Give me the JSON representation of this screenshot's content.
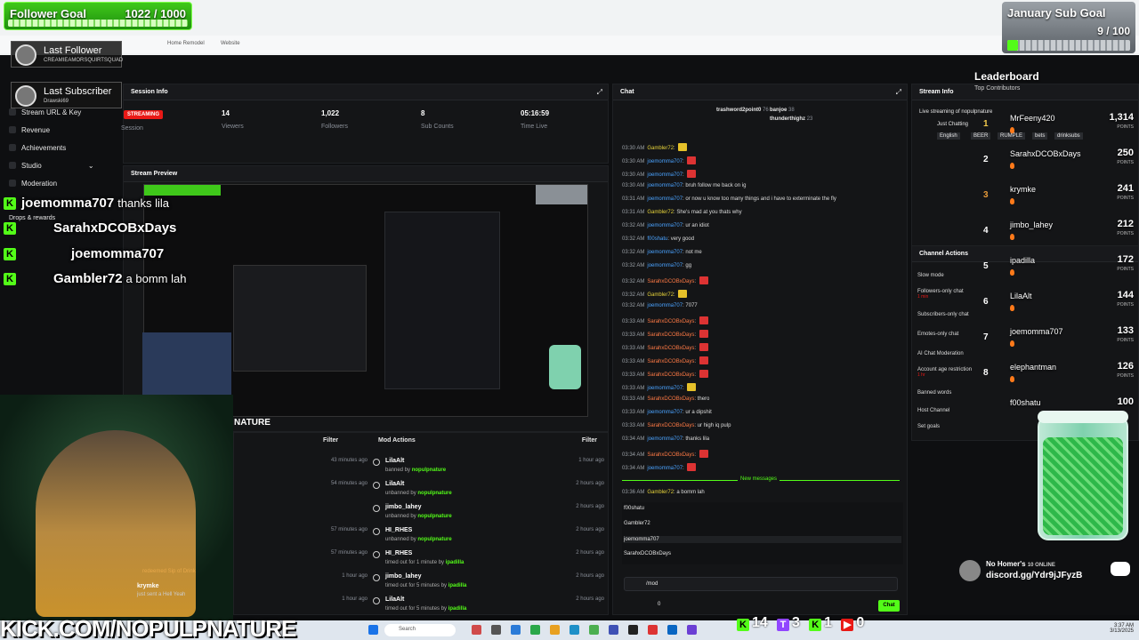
{
  "browser": {
    "bookmarks": [
      "Home Remodel",
      "Website"
    ]
  },
  "overlays": {
    "follower_goal": {
      "title": "Follower Goal",
      "value": "1022 / 1000",
      "progress": 1.0
    },
    "sub_goal": {
      "title": "January Sub Goal",
      "value": "9 / 100",
      "progress": 0.09
    },
    "last_follower": {
      "title": "Last Follower",
      "name": "CREAMIEAMORSQUIRTSQUAD"
    },
    "last_subscriber": {
      "title": "Last Subscriber",
      "name": "Drawski69"
    },
    "kick_url": "KICK.COM/NOPULPNATURE"
  },
  "sidebar": {
    "items": [
      {
        "label": "Stream URL & Key",
        "icon": "key-icon"
      },
      {
        "label": "Revenue",
        "icon": "revenue-icon"
      },
      {
        "label": "Achievements",
        "icon": "trophy-icon"
      },
      {
        "label": "Studio",
        "icon": "studio-icon"
      },
      {
        "label": "Moderation",
        "icon": "shield-icon"
      },
      {
        "label": "Drops & rewards",
        "icon": "gift-icon"
      }
    ]
  },
  "session": {
    "title": "Session Info",
    "status": "STREAMING",
    "session_label": "Session",
    "stats": [
      {
        "value": "14",
        "label": "Viewers"
      },
      {
        "value": "1,022",
        "label": "Followers"
      },
      {
        "value": "8",
        "label": "Sub Counts"
      },
      {
        "value": "05:16:59",
        "label": "Time Live"
      }
    ]
  },
  "preview": {
    "title": "Stream Preview"
  },
  "mod_actions": {
    "title": "Mod Actions",
    "filter": "Filter",
    "rows": [
      {
        "left_time": "43 minutes ago",
        "user": "LilaAlt",
        "action": "banned by",
        "by": "nopulpnature",
        "time": "1 hour ago"
      },
      {
        "left_time": "54 minutes ago",
        "user": "LilaAlt",
        "action": "unbanned by",
        "by": "nopulpnature",
        "time": "2 hours ago"
      },
      {
        "left_time": "",
        "user": "jimbo_lahey",
        "action": "unbanned by",
        "by": "nopulpnature",
        "time": "2 hours ago"
      },
      {
        "left_time": "57 minutes ago",
        "user": "HI_RHES",
        "action": "unbanned by",
        "by": "nopulpnature",
        "time": "2 hours ago"
      },
      {
        "left_time": "57 minutes ago",
        "user": "HI_RHES",
        "action": "timed out for 1 minute by",
        "by": "ipadilla",
        "time": "2 hours ago"
      },
      {
        "left_time": "1 hour ago",
        "user": "jimbo_lahey",
        "action": "timed out for 5 minutes by",
        "by": "ipadilla",
        "time": "2 hours ago"
      },
      {
        "left_time": "1 hour ago",
        "user": "LilaAlt",
        "action": "timed out for 5 minutes by",
        "by": "ipadilla",
        "time": "2 hours ago"
      }
    ],
    "left_filter": "Filter",
    "events": [
      {
        "text": "redeemed Sip of Drink"
      },
      {
        "user": "krymke",
        "text": "just sent a Hell Yeah"
      }
    ]
  },
  "chat": {
    "title": "Chat",
    "pinned": [
      {
        "name": "trashword2point0",
        "count": "76"
      },
      {
        "name": "banjoe",
        "count": "38"
      },
      {
        "name": "thunderthighz",
        "count": "23"
      }
    ],
    "messages": [
      {
        "time": "03:30 AM",
        "user": "Gambler72",
        "text": ""
      },
      {
        "time": "03:30 AM",
        "user": "joemomma707",
        "text": ""
      },
      {
        "time": "03:30 AM",
        "user": "joemomma707",
        "text": ""
      },
      {
        "time": "03:30 AM",
        "user": "joemomma707",
        "text": "bruh follow me back on ig"
      },
      {
        "time": "03:31 AM",
        "user": "joemomma707",
        "text": "or now u know too many things and i have to exterminate the fly"
      },
      {
        "time": "03:31 AM",
        "user": "Gambler72",
        "text": "She's mad at you thats why"
      },
      {
        "time": "03:32 AM",
        "user": "joemomma707",
        "text": "ur an idiot"
      },
      {
        "time": "03:32 AM",
        "user": "f00shatu",
        "text": "very good"
      },
      {
        "time": "03:32 AM",
        "user": "joemomma707",
        "text": "not me"
      },
      {
        "time": "03:32 AM",
        "user": "joemomma707",
        "text": "gg"
      },
      {
        "time": "03:32 AM",
        "user": "SarahxDCOBxDays",
        "text": ""
      },
      {
        "time": "03:32 AM",
        "user": "Gambler72",
        "text": ""
      },
      {
        "time": "03:32 AM",
        "user": "joemomma707",
        "text": "7077"
      },
      {
        "time": "03:33 AM",
        "user": "SarahxDCOBxDays",
        "text": ""
      },
      {
        "time": "03:33 AM",
        "user": "SarahxDCOBxDays",
        "text": ""
      },
      {
        "time": "03:33 AM",
        "user": "SarahxDCOBxDays",
        "text": ""
      },
      {
        "time": "03:33 AM",
        "user": "SarahxDCOBxDays",
        "text": ""
      },
      {
        "time": "03:33 AM",
        "user": "SarahxDCOBxDays",
        "text": ""
      },
      {
        "time": "03:33 AM",
        "user": "joemomma707",
        "text": ""
      },
      {
        "time": "03:33 AM",
        "user": "SarahxDCOBxDays",
        "text": "thero"
      },
      {
        "time": "03:33 AM",
        "user": "joemomma707",
        "text": "ur a dipshit"
      },
      {
        "time": "03:33 AM",
        "user": "SarahxDCOBxDays",
        "text": "ur high iq pulp"
      },
      {
        "time": "03:34 AM",
        "user": "joemomma707",
        "text": "thanks lila"
      },
      {
        "time": "03:34 AM",
        "user": "SarahxDCOBxDays",
        "text": ""
      },
      {
        "time": "03:34 AM",
        "user": "joemomma707",
        "text": ""
      }
    ],
    "new_messages": "New messages",
    "after": [
      {
        "time": "03:36 AM",
        "user": "Gambler72",
        "text": "a bomm lah"
      }
    ],
    "suggestions": [
      "f00shatu",
      "Gambler72",
      "joemomma707",
      "SarahxDCOBxDays"
    ],
    "input_value": "/mod",
    "viewer_count": "0",
    "send_label": "Chat"
  },
  "stream_info": {
    "title": "Stream Info",
    "live_text": "Live streaming of nopulpnature",
    "just_chatting": "Just Chatting",
    "tags": [
      "English",
      "BEER",
      "RUMPLE",
      "bets",
      "drinksubs"
    ]
  },
  "channel_actions": {
    "title": "Channel Actions",
    "items": [
      {
        "label": "Slow mode",
        "sub": ""
      },
      {
        "label": "Followers-only chat",
        "sub": "1 min"
      },
      {
        "label": "Subscribers-only chat",
        "sub": ""
      },
      {
        "label": "Emotes-only chat",
        "sub": ""
      },
      {
        "label": "AI Chat Moderation",
        "sub": ""
      },
      {
        "label": "Account age restriction",
        "sub": "1 hr"
      },
      {
        "label": "Banned words",
        "sub": ""
      },
      {
        "label": "Host Channel",
        "sub": ""
      },
      {
        "label": "Set goals",
        "sub": ""
      }
    ]
  },
  "leaderboard": {
    "title": "Leaderboard",
    "subtitle": "Top Contributors",
    "points_label": "POINTS",
    "rows": [
      {
        "rank": "1",
        "name": "MrFeeny420",
        "points": "1,314"
      },
      {
        "rank": "2",
        "name": "SarahxDCOBxDays",
        "points": "250"
      },
      {
        "rank": "3",
        "name": "krymke",
        "points": "241"
      },
      {
        "rank": "4",
        "name": "jimbo_lahey",
        "points": "212"
      },
      {
        "rank": "5",
        "name": "ipadilla",
        "points": "172"
      },
      {
        "rank": "6",
        "name": "LilaAlt",
        "points": "144"
      },
      {
        "rank": "7",
        "name": "joemomma707",
        "points": "133"
      },
      {
        "rank": "8",
        "name": "elephantman",
        "points": "126"
      },
      {
        "rank": "",
        "name": "f00shatu",
        "points": "100"
      }
    ]
  },
  "chat_overlay": [
    {
      "user": "joemomma707",
      "text": "thanks lila"
    },
    {
      "user": "SarahxDCOBxDays",
      "text": ""
    },
    {
      "user": "joemomma707",
      "text": ""
    },
    {
      "user": "Gambler72",
      "text": "a bomm lah"
    }
  ],
  "preview_overlay": {
    "label": "NATURE"
  },
  "discord": {
    "title": "No Homer's",
    "online": "10 ONLINE",
    "link": "discord.gg/Ydr9jJFyzB"
  },
  "taskbar": {
    "search": "Search",
    "time": "3:37 AM",
    "date": "3/13/2025",
    "counts": [
      "14",
      "3",
      "1",
      "0"
    ]
  },
  "colors": {
    "kick_green": "#53fc18",
    "live_red": "#e91916",
    "panel": "#141517"
  }
}
